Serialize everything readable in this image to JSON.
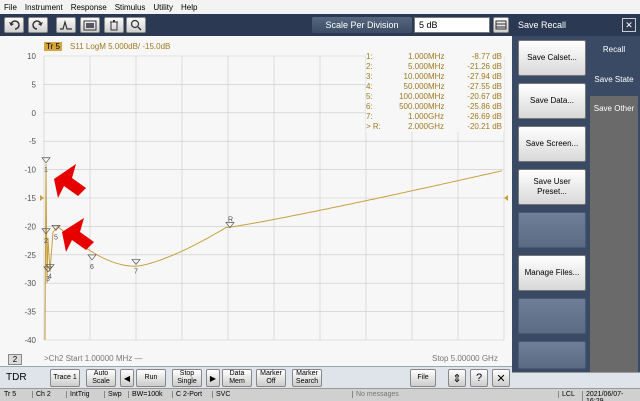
{
  "menu": [
    "File",
    "Instrument",
    "Response",
    "Stimulus",
    "Utility",
    "Help"
  ],
  "toolbar": {
    "scale_label": "Scale Per Division",
    "scale_value": "5 dB",
    "icons": [
      "undo-icon",
      "redo-icon",
      "marker-icon",
      "screenshot-icon",
      "trash-icon",
      "zoom-icon"
    ]
  },
  "trace": {
    "tag": "Tr 5",
    "header": "S11 LogM 5.000dB/ -15.0dB",
    "color": "#c8a040",
    "channel_badge": "2",
    "start_label": ">Ch2  Start  1.00000 MHz —",
    "stop_label": "Stop  5.00000 GHz"
  },
  "y_ticks": [
    "10",
    "5",
    "0",
    "-5",
    "-10",
    "-15",
    "-20",
    "-25",
    "-30",
    "-35",
    "-40"
  ],
  "markers": [
    {
      "id": "1:",
      "freq": "1.000",
      "unit": "MHz",
      "value": "-8.77 dB"
    },
    {
      "id": "2:",
      "freq": "5.000",
      "unit": "MHz",
      "value": "-21.26 dB"
    },
    {
      "id": "3:",
      "freq": "10.000",
      "unit": "MHz",
      "value": "-27.94 dB"
    },
    {
      "id": "4:",
      "freq": "50.000",
      "unit": "MHz",
      "value": "-27.55 dB"
    },
    {
      "id": "5:",
      "freq": "100.000",
      "unit": "MHz",
      "value": "-20.67 dB"
    },
    {
      "id": "6:",
      "freq": "500.000",
      "unit": "MHz",
      "value": "-25.86 dB"
    },
    {
      "id": "7:",
      "freq": "1.000",
      "unit": "GHz",
      "value": "-26.69 dB"
    },
    {
      "id": "> R:",
      "freq": "2.000",
      "unit": "GHz",
      "value": "-20.21 dB"
    }
  ],
  "marker_labels": [
    "1",
    "2",
    "3",
    "4",
    "5",
    "6",
    "7",
    "R"
  ],
  "right_panel": {
    "title": "Save Recall",
    "buttons": [
      "Save Calset...",
      "Save Data...",
      "Save Screen...",
      "Save User Preset...",
      "",
      "Manage Files...",
      "",
      ""
    ],
    "tabs": [
      "Recall",
      "Save State",
      "Save Other"
    ]
  },
  "bottom": {
    "mode": "TDR",
    "buttons": [
      "Trace 1",
      "Auto Scale",
      "Run",
      "Stop Single",
      "Data Mem",
      "Marker Off",
      "Marker Search"
    ],
    "file_label": "File",
    "help": "?",
    "close": "✕"
  },
  "status": {
    "tr": "Tr 5",
    "ch": "Ch 2",
    "trig": "IntTrig",
    "swp": "Swp",
    "bw": "BW=100k",
    "port": "C  2-Port",
    "svc": "SVC",
    "msg": "No messages",
    "lcl": "LCL",
    "datetime": "2021/06/07-16:29"
  }
}
